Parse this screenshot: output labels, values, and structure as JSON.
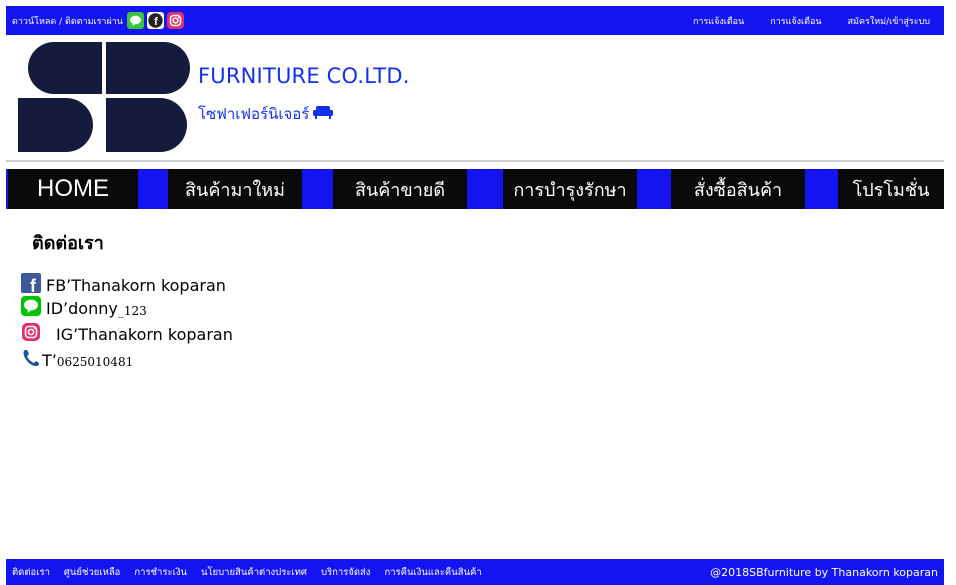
{
  "topbar": {
    "download_text": "ดาวน์โหลด / ติดตามเราผ่าน",
    "links": [
      "การแจ้งเตือน",
      "การแจ้งเตือน",
      "สมัครใหม่/เข้าสู่ระบบ"
    ]
  },
  "brand": {
    "name": "FURNITURE CO.LTD.",
    "subtitle": "โซฟาเฟอร์นิเจอร์"
  },
  "nav": {
    "items": [
      "HOME",
      "สินค้ามาใหม่",
      "สินค้าขายดี",
      "การบำรุงรักษา",
      "สั่งซื้อสินค้า",
      "โปรโมชั่น"
    ]
  },
  "contact": {
    "title": "ติดต่อเรา",
    "facebook": "FB’Thanakorn koparan",
    "line_prefix": "ID’donny",
    "line_suffix": "_123",
    "instagram": "IG’Thanakorn koparan",
    "phone_prefix": "T’",
    "phone_number": "0625010481"
  },
  "footer": {
    "links": [
      "ติดต่อเรา",
      "ศูนย์ช่วยเหลือ",
      "การชำระเงิน",
      "นโยบายสินค้าต่างประเทศ",
      "บริการจัดส่ง",
      "การคืนเงินและคืนสินค้า"
    ],
    "copyright": "@2018SBfurniture by Thanakorn koparan"
  },
  "colors": {
    "bar_blue": "#1414f0",
    "brand_blue": "#1530ea",
    "logo_navy": "#141b3d",
    "nav_black": "#0a0a0a"
  }
}
